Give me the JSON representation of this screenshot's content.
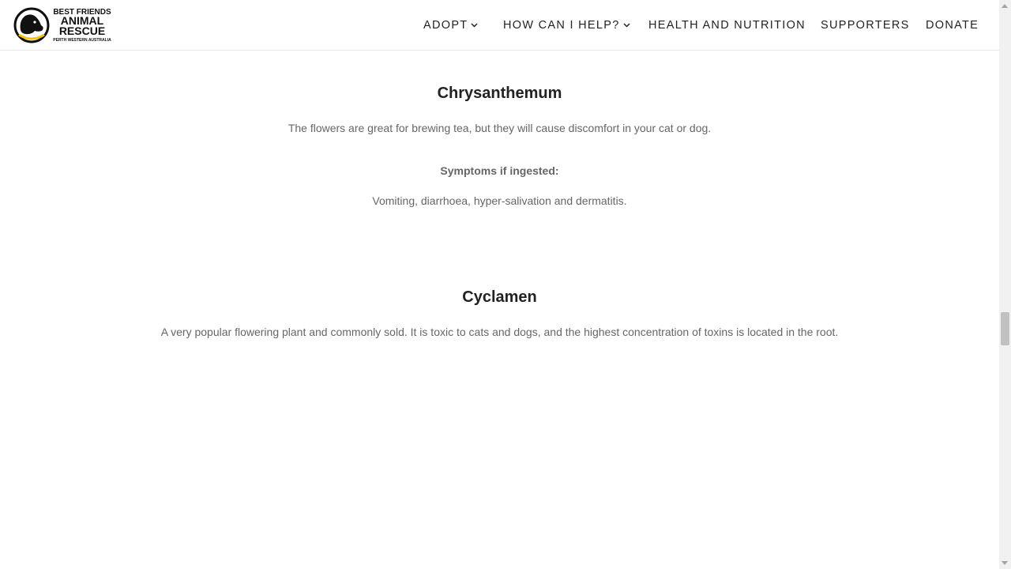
{
  "logo": {
    "line1": "BEST FRIENDS",
    "line2": "ANIMAL",
    "line3": "RESCUE",
    "line4": "PERTH WESTERN AUSTRALIA"
  },
  "nav": {
    "adopt": "ADOPT",
    "help": "HOW CAN I HELP?",
    "health": "HEALTH AND NUTRITION",
    "supporters": "SUPPORTERS",
    "donate": "DONATE"
  },
  "sections": {
    "chrysanthemum": {
      "title": "Chrysanthemum",
      "description": "The flowers are great for brewing tea, but they will cause discomfort in your cat or dog.",
      "symptoms_label": "Symptoms if ingested:",
      "symptoms": "Vomiting, diarrhoea, hyper-salivation and dermatitis."
    },
    "cyclamen": {
      "title": "Cyclamen",
      "description": "A very popular flowering plant and commonly sold. It is toxic to cats and dogs, and the highest concentration of toxins is located in the root."
    }
  },
  "colors": {
    "heading": "#222222",
    "body_text": "#666666",
    "logo_accent": "#f2c400"
  }
}
